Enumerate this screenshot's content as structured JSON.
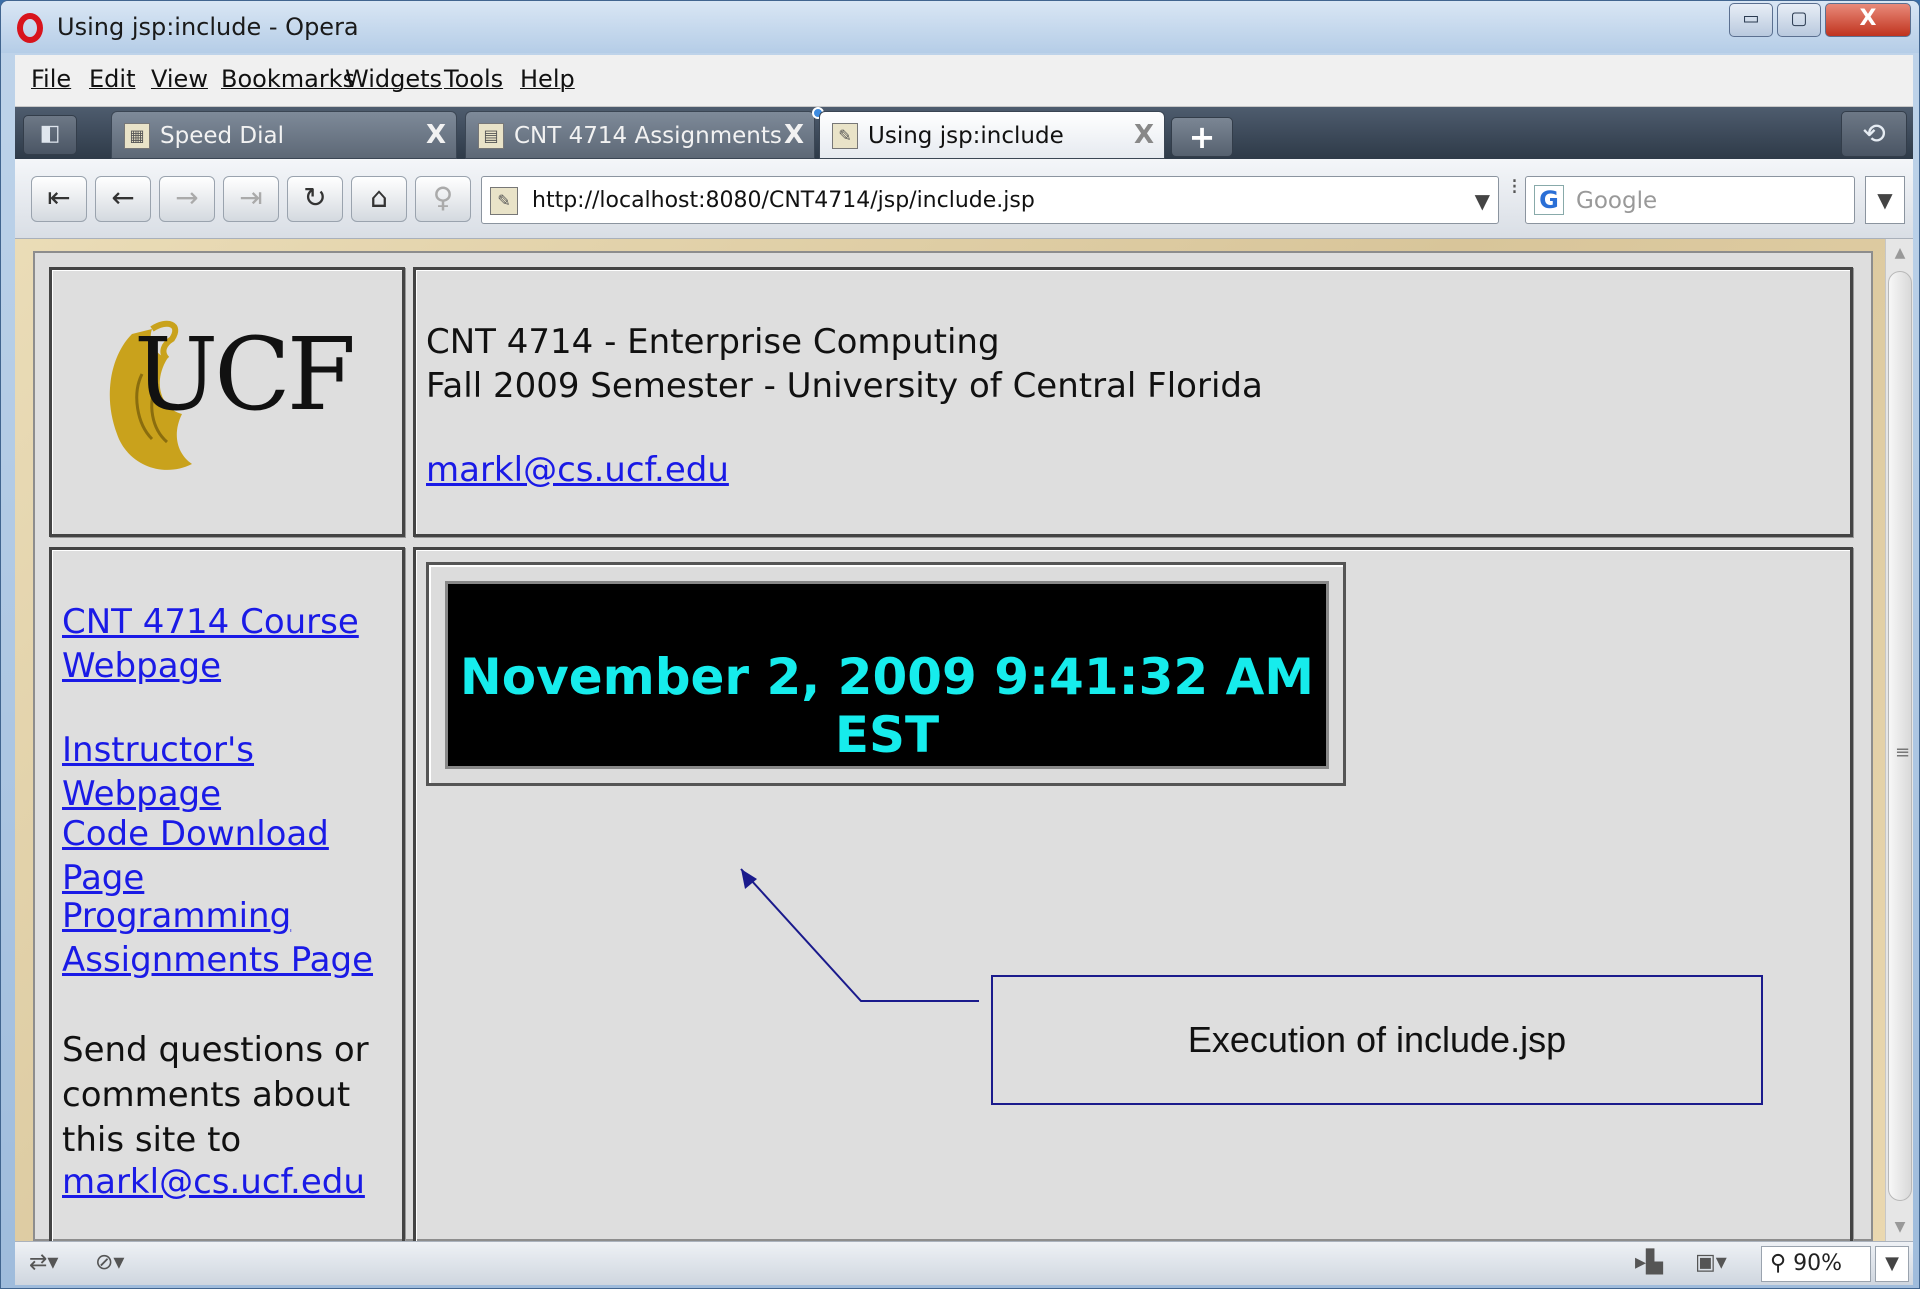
{
  "window": {
    "title": "Using jsp:include - Opera",
    "minimize_label": "▭",
    "maximize_label": "▢",
    "close_label": "X"
  },
  "menu": {
    "items": [
      "File",
      "Edit",
      "View",
      "Bookmarks",
      "Widgets",
      "Tools",
      "Help"
    ]
  },
  "tabs": [
    {
      "label": "Speed Dial",
      "icon": "speed-dial-icon",
      "active": false
    },
    {
      "label": "CNT 4714 Assignments",
      "icon": "page-icon",
      "active": false
    },
    {
      "label": "Using jsp:include",
      "icon": "page-icon",
      "active": true
    }
  ],
  "tab_close_label": "X",
  "new_tab_label": "+",
  "address": {
    "url": "http://localhost:8080/CNT4714/jsp/include.jsp",
    "dropdown": "▼"
  },
  "search": {
    "engine_icon": "G",
    "placeholder": "Google",
    "dropdown": "▼"
  },
  "nav_buttons": [
    {
      "name": "rewind-icon",
      "glyph": "⏮",
      "enabled": true
    },
    {
      "name": "back-icon",
      "glyph": "🡐",
      "enabled": true
    },
    {
      "name": "forward-icon",
      "glyph": "🡒",
      "enabled": false
    },
    {
      "name": "fast-forward-icon",
      "glyph": "⏭",
      "enabled": false
    },
    {
      "name": "reload-icon",
      "glyph": "↻",
      "enabled": true
    },
    {
      "name": "home-icon",
      "glyph": "⌂",
      "enabled": true
    },
    {
      "name": "wand-icon",
      "glyph": "⚲",
      "enabled": false
    }
  ],
  "page": {
    "logo_text": "UCF",
    "course_title": "CNT 4714 - Enterprise Computing",
    "semester": "Fall 2009 Semester - University of Central Florida",
    "header_email": "markl@cs.ucf.edu",
    "nav_links": {
      "course": "CNT 4714 Course Webpage",
      "instructor": "Instructor's Webpage",
      "code": "Code Download Page",
      "assignments": "Programming Assignments Page"
    },
    "contact_text": "Send questions or comments about this site to",
    "contact_email": "markl@cs.ucf.edu",
    "clock": "November 2, 2009 9:41:32 AM EST"
  },
  "annotation": {
    "text": "Execution of include.jsp"
  },
  "status": {
    "zoom": "90%",
    "zoom_dropdown": "▼"
  },
  "colors": {
    "link": "#1a1ae6",
    "clock_text": "#16ecec",
    "logo_gold": "#c9a21c"
  }
}
